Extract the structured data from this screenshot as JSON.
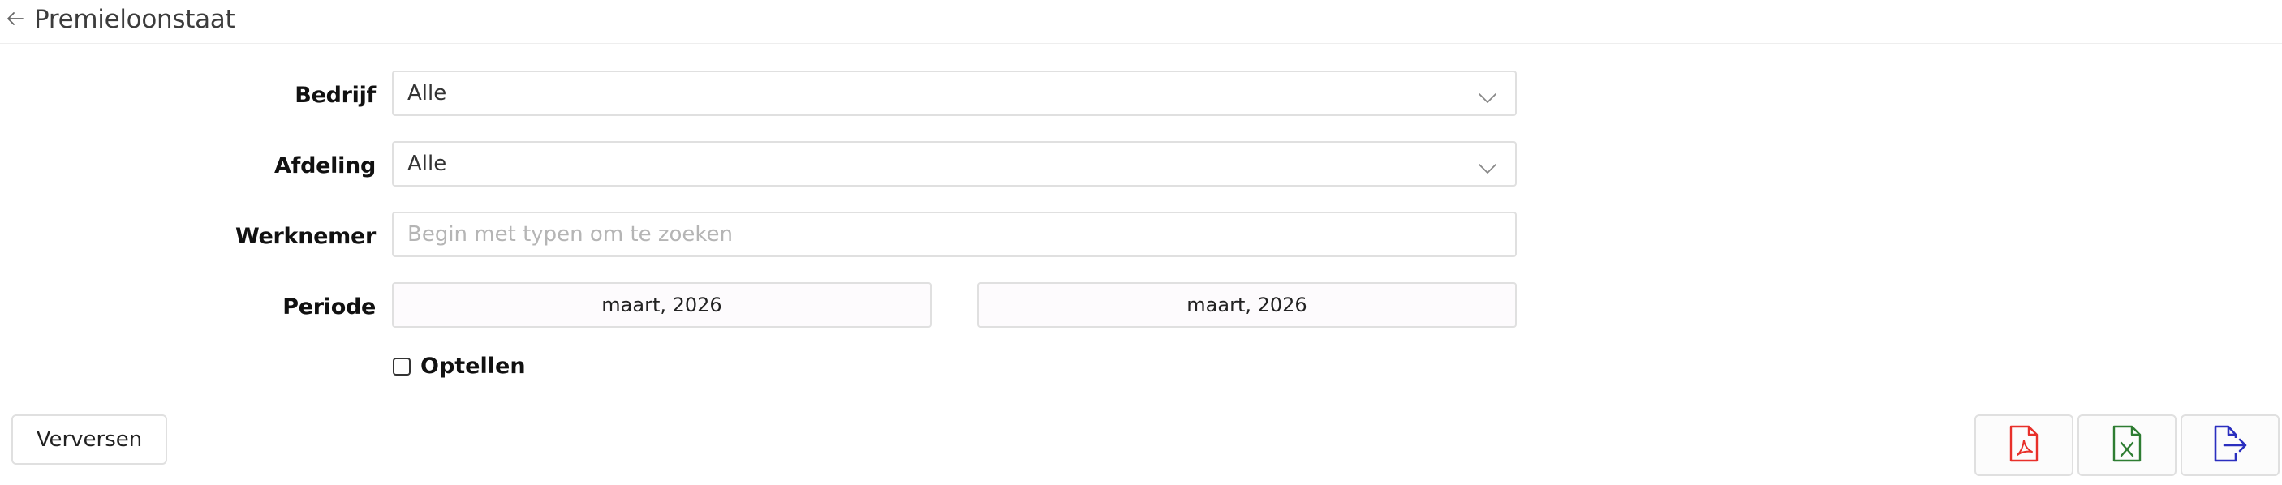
{
  "header": {
    "title": "Premieloonstaat",
    "back_icon": "arrow-left-icon"
  },
  "form": {
    "company": {
      "label": "Bedrijf",
      "value": "Alle"
    },
    "department": {
      "label": "Afdeling",
      "value": "Alle"
    },
    "employee": {
      "label": "Werknemer",
      "value": "",
      "placeholder": "Begin met typen om te zoeken"
    },
    "period": {
      "label": "Periode",
      "from": "maart, 2026",
      "to": "maart, 2026"
    },
    "sum_up": {
      "label": "Optellen",
      "checked": false
    }
  },
  "actions": {
    "refresh_label": "Verversen",
    "export_pdf_icon": "file-pdf-icon",
    "export_excel_icon": "file-excel-icon",
    "export_icon": "file-export-icon"
  },
  "colors": {
    "pdf": "#e8302a",
    "excel": "#2e7d32",
    "export": "#2b2fbf",
    "border": "#e0e0e0"
  }
}
